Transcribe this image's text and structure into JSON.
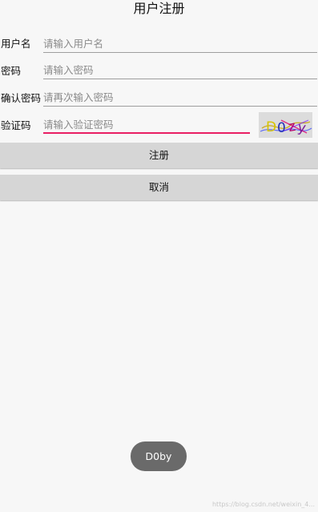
{
  "page": {
    "title": "用户注册"
  },
  "form": {
    "username": {
      "label": "用户名",
      "placeholder": "请输入用户名",
      "value": ""
    },
    "password": {
      "label": "密码",
      "placeholder": "请输入密码",
      "value": ""
    },
    "confirm_password": {
      "label": "确认密码",
      "placeholder": "请再次输入密码",
      "value": ""
    },
    "verification_code": {
      "label": "验证码",
      "placeholder": "请输入验证密码",
      "value": ""
    }
  },
  "captcha": {
    "text": "D0zy",
    "icon": "captcha-image"
  },
  "buttons": {
    "register": "注册",
    "cancel": "取消"
  },
  "toast": {
    "text": "D0by"
  },
  "watermark": {
    "text": "https://blog.csdn.net/weixin_4..."
  },
  "colors": {
    "accent": "#e91e63",
    "button_bg": "#d6d6d6",
    "toast_bg": "#6a6a6a",
    "background": "#f7f7f7"
  }
}
